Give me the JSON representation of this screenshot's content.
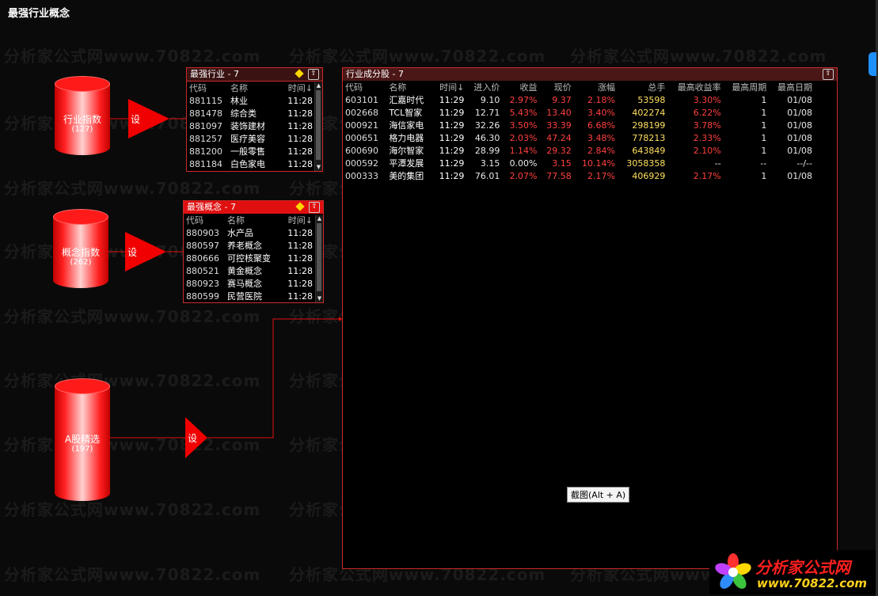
{
  "window": {
    "title": "最强行业概念"
  },
  "watermark": "分析家公式网www.70822.com",
  "nodes": {
    "industry_index": {
      "label": "行业指数",
      "count": "(127)"
    },
    "concept_index": {
      "label": "概念指数",
      "count": "(262)"
    },
    "a_share": {
      "label": "A股精选",
      "count": "(197)"
    },
    "set_label": "设"
  },
  "panel_industry": {
    "title": "最强行业 - 7",
    "headers": [
      "代码",
      "名称",
      "时间↓"
    ],
    "rows": [
      {
        "code": "881115",
        "name": "林业",
        "time": "11:28"
      },
      {
        "code": "881478",
        "name": "综合类",
        "time": "11:28"
      },
      {
        "code": "881097",
        "name": "装饰建材",
        "time": "11:28"
      },
      {
        "code": "881257",
        "name": "医疗美容",
        "time": "11:28"
      },
      {
        "code": "881200",
        "name": "一般零售",
        "time": "11:28"
      },
      {
        "code": "881184",
        "name": "白色家电",
        "time": "11:28"
      }
    ]
  },
  "panel_concept": {
    "title": "最强概念 - 7",
    "headers": [
      "代码",
      "名称",
      "时间↓"
    ],
    "rows": [
      {
        "code": "880903",
        "name": "水产品",
        "time": "11:28"
      },
      {
        "code": "880597",
        "name": "养老概念",
        "time": "11:28"
      },
      {
        "code": "880666",
        "name": "可控核聚变",
        "time": "11:28"
      },
      {
        "code": "880521",
        "name": "黄金概念",
        "time": "11:28"
      },
      {
        "code": "880923",
        "name": "赛马概念",
        "time": "11:28"
      },
      {
        "code": "880599",
        "name": "民营医院",
        "time": "11:28"
      }
    ]
  },
  "panel_stocks": {
    "title": "行业成分股 - 7",
    "headers": [
      "代码",
      "名称",
      "时间↓",
      "进入价",
      "收益",
      "现价",
      "涨幅",
      "总手",
      "最高收益率",
      "最高周期",
      "最高日期"
    ],
    "rows": [
      {
        "code": "603101",
        "name": "汇嘉时代",
        "time": "11:29",
        "entry": "9.10",
        "gain": "2.97%",
        "price": "9.37",
        "pct": "2.18%",
        "vol": "53598",
        "maxgain": "3.30%",
        "period": "1",
        "date": "01/08"
      },
      {
        "code": "002668",
        "name": "TCL智家",
        "time": "11:29",
        "entry": "12.71",
        "gain": "5.43%",
        "price": "13.40",
        "pct": "3.40%",
        "vol": "402274",
        "maxgain": "6.22%",
        "period": "1",
        "date": "01/08"
      },
      {
        "code": "000921",
        "name": "海信家电",
        "time": "11:29",
        "entry": "32.26",
        "gain": "3.50%",
        "price": "33.39",
        "pct": "6.68%",
        "vol": "298199",
        "maxgain": "3.78%",
        "period": "1",
        "date": "01/08"
      },
      {
        "code": "000651",
        "name": "格力电器",
        "time": "11:29",
        "entry": "46.30",
        "gain": "2.03%",
        "price": "47.24",
        "pct": "3.48%",
        "vol": "778213",
        "maxgain": "2.33%",
        "period": "1",
        "date": "01/08"
      },
      {
        "code": "600690",
        "name": "海尔智家",
        "time": "11:29",
        "entry": "28.99",
        "gain": "1.14%",
        "price": "29.32",
        "pct": "2.84%",
        "vol": "643849",
        "maxgain": "2.10%",
        "period": "1",
        "date": "01/08"
      },
      {
        "code": "000592",
        "name": "平潭发展",
        "time": "11:29",
        "entry": "3.15",
        "gain": "0.00%",
        "price": "3.15",
        "pct": "10.14%",
        "vol": "3058358",
        "maxgain": "--",
        "period": "--",
        "date": "--/--"
      },
      {
        "code": "000333",
        "name": "美的集团",
        "time": "11:29",
        "entry": "76.01",
        "gain": "2.07%",
        "price": "77.58",
        "pct": "2.17%",
        "vol": "406929",
        "maxgain": "2.17%",
        "period": "1",
        "date": "01/08"
      }
    ]
  },
  "tooltip": "截图(Alt + A)",
  "logo": {
    "name": "分析家公式网",
    "url": "www.70822.com"
  },
  "colors": {
    "accent": "#e01010",
    "gain": "#ff4040",
    "volume": "#ffe060",
    "background": "#0a0a0a"
  }
}
